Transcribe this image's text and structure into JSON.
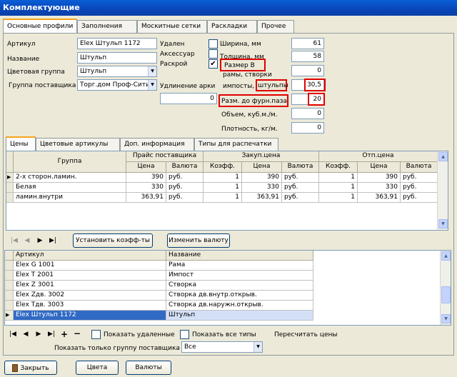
{
  "window": {
    "title": "Комплектующие"
  },
  "top_tabs": [
    "Основные профили",
    "Заполнения",
    "Москитные сетки",
    "Раскладки",
    "Прочее"
  ],
  "form": {
    "article_label": "Артикул",
    "article_value": "Elex Штульп 1172",
    "name_label": "Название",
    "name_value": "Штульп",
    "color_group_label": "Цветовая группа",
    "color_group_value": "Штульп",
    "supplier_group_label": "Группа поставщика",
    "supplier_group_value": "Торг.дом Проф-Сити",
    "deleted_label": "Удален",
    "accessory_label": "Аксессуар",
    "cutting_label": "Раскрой",
    "cutting_check": "✔",
    "arch_label": "Удлинение арки",
    "arch_value": "0",
    "width_label": "Ширина, мм",
    "width_value": "61",
    "thickness_label": "Толщина, мм",
    "thickness_value": "58",
    "size_b_label": "Размер В",
    "frames_label": "рамы, створки",
    "frames_value": "0",
    "imposts_label": "импосты,",
    "shtulp_label": "штульпы",
    "imposts_value": "30,5",
    "groove_label": "Разм. до фурн.паза",
    "groove_value": "20",
    "volume_label": "Объем, куб.м./м.",
    "volume_value": "0",
    "density_label": "Плотность, кг/м.",
    "density_value": "0"
  },
  "mid_tabs": [
    "Цены",
    "Цветовые артикулы",
    "Доп. информация",
    "Типы для распечатки"
  ],
  "price_grid": {
    "group_header": "Группа",
    "supplier_header": "Прайс поставщика",
    "purchase_header": "Закуп.цена",
    "release_header": "Отп.цена",
    "sub_price": "Цена",
    "sub_currency": "Валюта",
    "sub_coef": "Коэфф.",
    "rows": [
      {
        "group": "2-х сторон.ламин.",
        "p1": "390",
        "c1": "руб.",
        "k2": "1",
        "p2": "390",
        "c2": "руб.",
        "k3": "1",
        "p3": "390",
        "c3": "руб."
      },
      {
        "group": "Белая",
        "p1": "330",
        "c1": "руб.",
        "k2": "1",
        "p2": "330",
        "c2": "руб.",
        "k3": "1",
        "p3": "330",
        "c3": "руб."
      },
      {
        "group": "ламин.внутри",
        "p1": "363,91",
        "c1": "руб.",
        "k2": "1",
        "p2": "363,91",
        "c2": "руб.",
        "k3": "1",
        "p3": "363,91",
        "c3": "руб."
      }
    ]
  },
  "mid_buttons": {
    "set_coef": "Установить коэфф-ты",
    "change_currency": "Изменить валюту"
  },
  "article_grid": {
    "col_article": "Артикул",
    "col_name": "Название",
    "rows": [
      {
        "article": "Elex G 1001",
        "name": "Рама"
      },
      {
        "article": "Elex T 2001",
        "name": "Импост"
      },
      {
        "article": "Elex Z 3001",
        "name": "Створка"
      },
      {
        "article": "Elex Zдв. 3002",
        "name": "Створка дв.внутр.открыв."
      },
      {
        "article": "Elex Tдв. 3003",
        "name": "Створка дв.наружн.открыв."
      },
      {
        "article": "Elex Штульп 1172",
        "name": "Штульп"
      }
    ]
  },
  "bottom": {
    "show_deleted": "Показать удаленные",
    "show_all_types": "Показать все типы",
    "recalc_prices": "Пересчитать цены",
    "supplier_only_label": "Показать только группу поставщика",
    "supplier_only_value": "Все",
    "close_btn": "Закрыть",
    "colors_btn": "Цвета",
    "currencies_btn": "Валюты"
  }
}
